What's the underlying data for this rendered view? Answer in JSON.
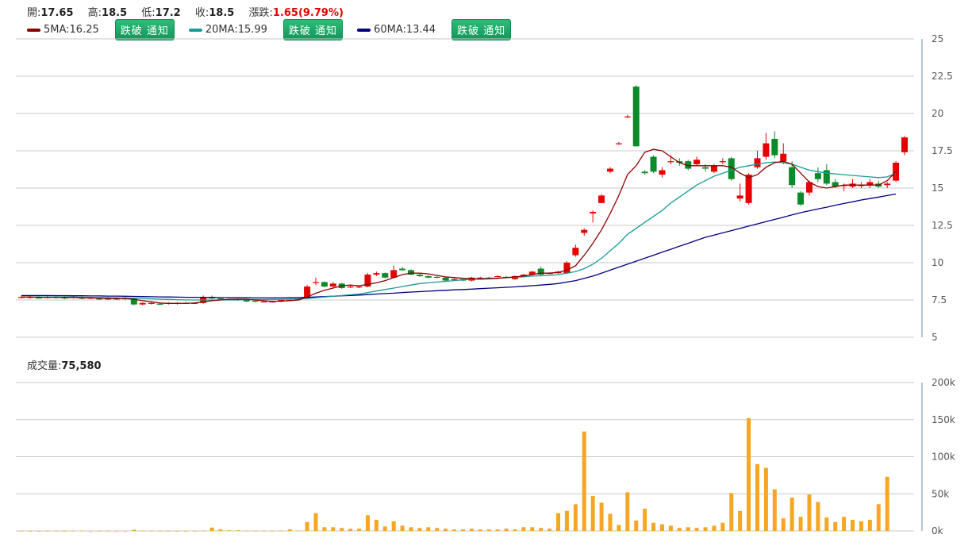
{
  "header": {
    "open_label": "開:",
    "open": "17.65",
    "high_label": "高:",
    "high": "18.5",
    "low_label": "低:",
    "low": "17.2",
    "close_label": "收:",
    "close": "18.5",
    "change_label": "漲跌:",
    "change": "1.65(9.79%)"
  },
  "ma": [
    {
      "label": "5MA:16.25",
      "color": "#8b0000",
      "button": "跌破 通知"
    },
    {
      "label": "20MA:15.99",
      "color": "#1a9a9a",
      "button": "跌破 通知"
    },
    {
      "label": "60MA:13.44",
      "color": "#000080"
    }
  ],
  "volume": {
    "label": "成交量:",
    "value": "75,580"
  },
  "colors": {
    "up": "#e60000",
    "down": "#0a8a2a",
    "volume": "#f5a623",
    "grid": "#c8c8c8"
  },
  "chart_data": {
    "type": "candlestick",
    "price_axis": {
      "min": 5,
      "max": 25,
      "ticks": [
        "25",
        "22.5",
        "20",
        "17.5",
        "15",
        "12.5",
        "10",
        "7.5",
        "5"
      ]
    },
    "volume_axis": {
      "min": 0,
      "max": 200000,
      "ticks": [
        "200k",
        "150k",
        "100k",
        "50k",
        "0k"
      ]
    },
    "candles": [
      [
        7.7,
        7.7,
        7.8,
        7.6
      ],
      [
        7.7,
        7.7,
        7.8,
        7.6
      ],
      [
        7.7,
        7.6,
        7.8,
        7.6
      ],
      [
        7.65,
        7.7,
        7.8,
        7.6
      ],
      [
        7.7,
        7.65,
        7.8,
        7.6
      ],
      [
        7.7,
        7.6,
        7.8,
        7.55
      ],
      [
        7.65,
        7.7,
        7.8,
        7.6
      ],
      [
        7.65,
        7.6,
        7.75,
        7.55
      ],
      [
        7.6,
        7.65,
        7.7,
        7.55
      ],
      [
        7.6,
        7.55,
        7.7,
        7.5
      ],
      [
        7.6,
        7.6,
        7.7,
        7.5
      ],
      [
        7.6,
        7.6,
        7.7,
        7.5
      ],
      [
        7.65,
        7.55,
        7.7,
        7.5
      ],
      [
        7.6,
        7.2,
        7.65,
        7.15
      ],
      [
        7.2,
        7.3,
        7.35,
        7.15
      ],
      [
        7.3,
        7.3,
        7.4,
        7.2
      ],
      [
        7.25,
        7.2,
        7.3,
        7.15
      ],
      [
        7.25,
        7.3,
        7.35,
        7.2
      ],
      [
        7.25,
        7.3,
        7.35,
        7.2
      ],
      [
        7.3,
        7.3,
        7.35,
        7.25
      ],
      [
        7.3,
        7.3,
        7.35,
        7.25
      ],
      [
        7.3,
        7.7,
        7.8,
        7.25
      ],
      [
        7.7,
        7.6,
        7.8,
        7.55
      ],
      [
        7.6,
        7.55,
        7.65,
        7.5
      ],
      [
        7.55,
        7.55,
        7.6,
        7.5
      ],
      [
        7.55,
        7.5,
        7.6,
        7.45
      ],
      [
        7.5,
        7.4,
        7.55,
        7.35
      ],
      [
        7.45,
        7.4,
        7.5,
        7.35
      ],
      [
        7.4,
        7.4,
        7.45,
        7.35
      ],
      [
        7.4,
        7.4,
        7.45,
        7.35
      ],
      [
        7.4,
        7.5,
        7.55,
        7.35
      ],
      [
        7.5,
        7.5,
        7.55,
        7.45
      ],
      [
        7.5,
        7.6,
        7.65,
        7.45
      ],
      [
        7.6,
        8.4,
        8.5,
        7.55
      ],
      [
        8.7,
        8.7,
        9.0,
        8.5
      ],
      [
        8.7,
        8.4,
        8.75,
        8.35
      ],
      [
        8.4,
        8.6,
        8.7,
        8.35
      ],
      [
        8.6,
        8.3,
        8.65,
        8.25
      ],
      [
        8.35,
        8.4,
        8.5,
        8.3
      ],
      [
        8.35,
        8.4,
        8.45,
        8.3
      ],
      [
        8.4,
        9.2,
        9.3,
        8.35
      ],
      [
        9.2,
        9.3,
        9.4,
        9.1
      ],
      [
        9.3,
        9.0,
        9.35,
        8.95
      ],
      [
        9.0,
        9.5,
        9.8,
        8.95
      ],
      [
        9.6,
        9.5,
        9.7,
        9.45
      ],
      [
        9.5,
        9.2,
        9.55,
        9.15
      ],
      [
        9.2,
        9.1,
        9.25,
        9.05
      ],
      [
        9.1,
        9.0,
        9.15,
        8.95
      ],
      [
        9.05,
        9.0,
        9.1,
        8.95
      ],
      [
        9.0,
        8.8,
        9.05,
        8.75
      ],
      [
        8.9,
        8.9,
        8.95,
        8.85
      ],
      [
        8.9,
        8.8,
        8.95,
        8.75
      ],
      [
        8.8,
        9.0,
        9.05,
        8.75
      ],
      [
        9.0,
        9.0,
        9.05,
        8.95
      ],
      [
        9.0,
        9.0,
        9.05,
        8.95
      ],
      [
        9.1,
        9.1,
        9.15,
        9.05
      ],
      [
        9.05,
        9.0,
        9.1,
        8.95
      ],
      [
        8.9,
        9.1,
        9.15,
        8.85
      ],
      [
        9.1,
        9.2,
        9.25,
        9.05
      ],
      [
        9.2,
        9.4,
        9.45,
        9.15
      ],
      [
        9.6,
        9.2,
        9.75,
        9.15
      ],
      [
        9.3,
        9.3,
        9.35,
        9.25
      ],
      [
        9.3,
        9.4,
        9.45,
        9.25
      ],
      [
        9.3,
        10.0,
        10.1,
        9.25
      ],
      [
        10.5,
        11.0,
        11.2,
        10.4
      ],
      [
        12.0,
        12.2,
        12.3,
        11.8
      ],
      [
        13.3,
        13.4,
        13.5,
        12.7
      ],
      [
        14.0,
        14.5,
        14.6,
        14.0
      ],
      [
        16.1,
        16.3,
        16.4,
        16.0
      ],
      [
        18.0,
        18.0,
        18.1,
        17.9
      ],
      [
        19.8,
        19.8,
        19.9,
        19.7
      ],
      [
        21.8,
        17.8,
        21.9,
        17.8
      ],
      [
        16.1,
        16.0,
        16.2,
        15.9
      ],
      [
        17.1,
        16.1,
        17.2,
        16.0
      ],
      [
        15.9,
        16.2,
        16.4,
        15.7
      ],
      [
        16.8,
        16.8,
        17.2,
        16.6
      ],
      [
        16.8,
        16.7,
        17.0,
        16.5
      ],
      [
        16.8,
        16.3,
        16.9,
        16.2
      ],
      [
        16.6,
        16.9,
        17.1,
        16.5
      ],
      [
        16.4,
        16.3,
        16.6,
        16.1
      ],
      [
        16.1,
        16.5,
        16.6,
        16.0
      ],
      [
        16.8,
        16.8,
        17.0,
        16.6
      ],
      [
        17.0,
        15.6,
        17.1,
        15.5
      ],
      [
        14.3,
        14.5,
        15.3,
        14.1
      ],
      [
        14.0,
        15.9,
        16.0,
        13.9
      ],
      [
        16.4,
        17.0,
        17.5,
        16.3
      ],
      [
        17.1,
        18.0,
        18.7,
        16.9
      ],
      [
        18.3,
        17.2,
        18.8,
        17.0
      ],
      [
        16.8,
        17.3,
        18.0,
        16.6
      ],
      [
        16.4,
        15.2,
        16.8,
        15.0
      ],
      [
        14.7,
        13.9,
        14.8,
        13.8
      ],
      [
        14.7,
        15.4,
        15.5,
        14.5
      ],
      [
        16.0,
        15.6,
        16.4,
        15.4
      ],
      [
        16.2,
        15.3,
        16.6,
        15.2
      ],
      [
        15.4,
        15.1,
        15.6,
        15.0
      ],
      [
        15.2,
        15.2,
        15.3,
        14.8
      ],
      [
        15.1,
        15.3,
        15.6,
        15.0
      ],
      [
        15.2,
        15.2,
        15.4,
        15.0
      ],
      [
        15.2,
        15.4,
        15.6,
        15.0
      ],
      [
        15.3,
        15.1,
        15.5,
        15.0
      ],
      [
        15.2,
        15.3,
        15.4,
        15.0
      ],
      [
        15.5,
        16.7,
        16.8,
        15.4
      ],
      [
        17.4,
        18.4,
        18.5,
        17.2
      ]
    ],
    "volumes": [
      200,
      150,
      100,
      150,
      200,
      100,
      200,
      300,
      100,
      150,
      200,
      100,
      100,
      1500,
      400,
      300,
      200,
      100,
      100,
      100,
      200,
      400,
      4500,
      2000,
      800,
      800,
      300,
      200,
      300,
      300,
      300,
      2000,
      500,
      12000,
      24000,
      5000,
      5000,
      4000,
      3000,
      3000,
      21000,
      15000,
      6000,
      13000,
      7000,
      5000,
      4000,
      5000,
      4000,
      3000,
      2000,
      2000,
      3000,
      2000,
      2000,
      2000,
      3000,
      2000,
      5000,
      5000,
      4000,
      3000,
      24000,
      27000,
      36000,
      134000,
      47000,
      38000,
      23000,
      8000,
      52000,
      14000,
      30000,
      11000,
      9000,
      7000,
      4000,
      5000,
      4000,
      5000,
      7000,
      11000,
      51000,
      27000,
      152000,
      90000,
      85000,
      56000,
      17000,
      45000,
      19000,
      49000,
      39000,
      18000,
      12000,
      19000,
      15000,
      13000,
      15000,
      36000,
      73000
    ],
    "ma5": [
      7.7,
      7.7,
      7.68,
      7.68,
      7.68,
      7.67,
      7.66,
      7.65,
      7.64,
      7.62,
      7.6,
      7.6,
      7.6,
      7.55,
      7.45,
      7.38,
      7.3,
      7.27,
      7.27,
      7.28,
      7.3,
      7.38,
      7.45,
      7.5,
      7.55,
      7.55,
      7.55,
      7.5,
      7.45,
      7.4,
      7.42,
      7.46,
      7.5,
      7.7,
      7.95,
      8.15,
      8.3,
      8.45,
      8.5,
      8.45,
      8.55,
      8.65,
      8.8,
      9.0,
      9.2,
      9.3,
      9.3,
      9.25,
      9.15,
      9.05,
      9.0,
      8.95,
      8.92,
      8.9,
      8.92,
      8.95,
      9.0,
      9.05,
      9.1,
      9.2,
      9.3,
      9.3,
      9.35,
      9.5,
      9.8,
      10.5,
      11.3,
      12.2,
      13.3,
      14.5,
      15.9,
      16.5,
      17.4,
      17.6,
      17.5,
      17.1,
      16.7,
      16.5,
      16.5,
      16.5,
      16.5,
      16.5,
      16.4,
      16.0,
      15.7,
      15.9,
      16.4,
      16.7,
      16.8,
      16.6,
      16.0,
      15.4,
      15.1,
      15.0,
      15.1,
      15.2,
      15.2,
      15.2,
      15.2,
      15.2,
      15.5,
      16.1
    ],
    "ma20": [
      7.7,
      7.7,
      7.7,
      7.7,
      7.7,
      7.7,
      7.7,
      7.68,
      7.67,
      7.66,
      7.65,
      7.64,
      7.63,
      7.62,
      7.6,
      7.58,
      7.56,
      7.54,
      7.52,
      7.5,
      7.5,
      7.5,
      7.5,
      7.5,
      7.5,
      7.5,
      7.52,
      7.53,
      7.53,
      7.54,
      7.55,
      7.56,
      7.58,
      7.6,
      7.65,
      7.7,
      7.75,
      7.8,
      7.85,
      7.9,
      8.0,
      8.1,
      8.2,
      8.3,
      8.4,
      8.5,
      8.6,
      8.65,
      8.7,
      8.75,
      8.8,
      8.85,
      8.9,
      8.92,
      8.95,
      8.97,
      9.0,
      9.02,
      9.05,
      9.1,
      9.12,
      9.15,
      9.2,
      9.3,
      9.4,
      9.6,
      9.9,
      10.3,
      10.8,
      11.3,
      11.9,
      12.3,
      12.7,
      13.1,
      13.5,
      14.0,
      14.4,
      14.8,
      15.2,
      15.5,
      15.8,
      16.0,
      16.2,
      16.4,
      16.5,
      16.6,
      16.7,
      16.75,
      16.7,
      16.6,
      16.4,
      16.2,
      16.1,
      16.0,
      15.95,
      15.9,
      15.85,
      15.8,
      15.75,
      15.7,
      15.75,
      15.99
    ],
    "ma60": [
      7.8,
      7.8,
      7.8,
      7.8,
      7.79,
      7.79,
      7.78,
      7.78,
      7.77,
      7.77,
      7.76,
      7.76,
      7.75,
      7.74,
      7.73,
      7.72,
      7.71,
      7.7,
      7.69,
      7.68,
      7.68,
      7.67,
      7.67,
      7.66,
      7.66,
      7.65,
      7.65,
      7.64,
      7.64,
      7.64,
      7.64,
      7.65,
      7.66,
      7.68,
      7.7,
      7.73,
      7.75,
      7.78,
      7.8,
      7.83,
      7.86,
      7.9,
      7.93,
      7.96,
      8.0,
      8.03,
      8.06,
      8.09,
      8.12,
      8.15,
      8.18,
      8.2,
      8.23,
      8.26,
      8.29,
      8.32,
      8.35,
      8.38,
      8.42,
      8.46,
      8.5,
      8.55,
      8.6,
      8.7,
      8.8,
      8.95,
      9.1,
      9.3,
      9.5,
      9.7,
      9.9,
      10.1,
      10.3,
      10.5,
      10.7,
      10.9,
      11.1,
      11.3,
      11.5,
      11.7,
      11.85,
      12.0,
      12.15,
      12.3,
      12.45,
      12.6,
      12.75,
      12.9,
      13.05,
      13.2,
      13.35,
      13.48,
      13.6,
      13.72,
      13.85,
      13.97,
      14.08,
      14.2,
      14.3,
      14.4,
      14.5,
      14.6
    ]
  }
}
